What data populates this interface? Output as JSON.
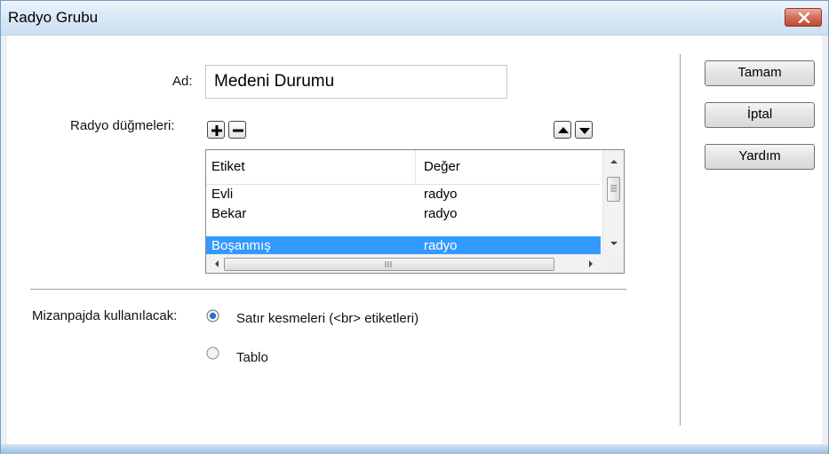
{
  "window": {
    "title": "Radyo Grubu"
  },
  "form": {
    "name_label": "Ad:",
    "name_value": "Medeni Durumu",
    "radio_buttons_label": "Radyo düğmeleri:",
    "list": {
      "columns": [
        "Etiket",
        "Değer"
      ],
      "rows": [
        {
          "label": "Evli",
          "value": "radyo"
        },
        {
          "label": "Bekar",
          "value": "radyo"
        },
        {
          "label": "Boşanmış",
          "value": "radyo",
          "selected": true
        }
      ]
    },
    "layout_label": "Mizanpajda kullanılacak:",
    "layout_options": [
      {
        "label": "Satır kesmeleri (<br> etiketleri)",
        "checked": true
      },
      {
        "label": "Tablo",
        "checked": false
      }
    ]
  },
  "buttons": {
    "ok": "Tamam",
    "cancel": "İptal",
    "help": "Yardım"
  },
  "icons": {
    "close": "close-icon",
    "add": "plus-icon",
    "remove": "minus-icon",
    "move_up": "arrow-up-icon",
    "move_down": "arrow-down-icon"
  },
  "colors": {
    "selection": "#3399ff",
    "close_button": "#c9503a",
    "title_bar": "#dbe8f6"
  }
}
